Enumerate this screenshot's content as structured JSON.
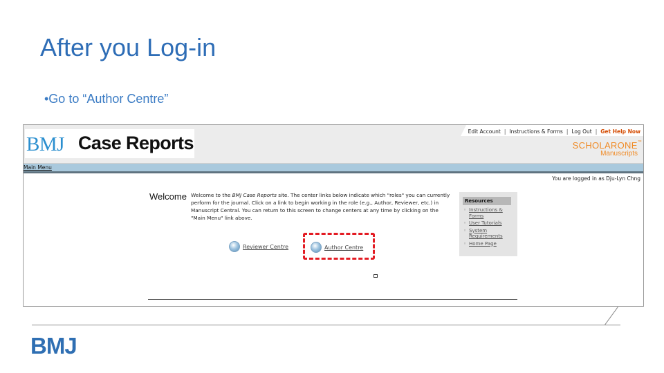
{
  "slide": {
    "title": "After you Log-in",
    "bullet": "•Go to “Author Centre”",
    "footer_logo": "BMJ"
  },
  "screenshot": {
    "logo_bmj": "BMJ",
    "logo_case_reports": "Case Reports",
    "top_links": {
      "edit_account": "Edit Account",
      "instructions": "Instructions & Forms",
      "log_out": "Log Out",
      "get_help": "Get Help Now",
      "separator": "|"
    },
    "scholarone": "SCHOLARONE",
    "scholarone_tm": "™",
    "manuscripts": "Manuscripts",
    "menu_main": "Main Menu",
    "logged_in": "You are logged in as Dju-Lyn Chng",
    "welcome_heading": "Welcome",
    "welcome_text_1": "Welcome to the ",
    "welcome_text_journal": "BMJ Case Reports",
    "welcome_text_2": " site. The center links below indicate which \"roles\" you can currently perform for the journal. Click on a link to begin working in the role (e.g., Author, Reviewer, etc.) in Manuscript Central. You can return to this screen to change centers at any time by clicking on the \"Main Menu\" link above.",
    "reviewer_centre": "Reviewer Centre",
    "author_centre": "Author Centre",
    "resources": {
      "heading": "Resources",
      "items": [
        "Instructions & Forms",
        "User Tutorials",
        "System Requirements",
        "Home Page"
      ]
    }
  },
  "colors": {
    "title_blue": "#2e6db6",
    "highlight_red": "#e31b23",
    "scholarone_orange": "#f08a24"
  }
}
